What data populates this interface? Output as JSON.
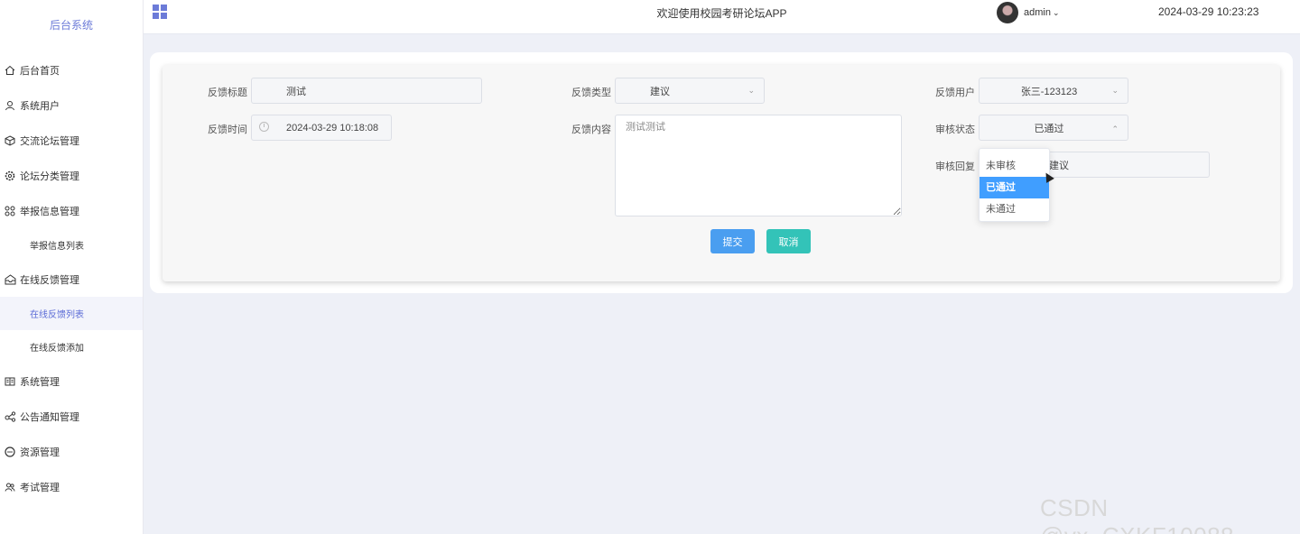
{
  "sidebar": {
    "brand": "后台系统",
    "items": [
      {
        "label": "后台首页",
        "icon": "home-icon"
      },
      {
        "label": "系统用户",
        "icon": "user-icon"
      },
      {
        "label": "交流论坛管理",
        "icon": "cube-icon"
      },
      {
        "label": "论坛分类管理",
        "icon": "gear-icon"
      },
      {
        "label": "举报信息管理",
        "icon": "apps-icon"
      },
      {
        "label": "举报信息列表"
      },
      {
        "label": "在线反馈管理",
        "icon": "inbox-icon"
      },
      {
        "label": "在线反馈列表"
      },
      {
        "label": "在线反馈添加"
      },
      {
        "label": "系统管理",
        "icon": "book-icon"
      },
      {
        "label": "公告通知管理",
        "icon": "share-icon"
      },
      {
        "label": "资源管理",
        "icon": "chat-icon"
      },
      {
        "label": "考试管理",
        "icon": "people-icon"
      }
    ]
  },
  "header": {
    "title": "欢迎使用校园考研论坛APP",
    "user": "admin",
    "datetime": "2024-03-29 10:23:23"
  },
  "form": {
    "title_label": "反馈标题",
    "title_value": "测试",
    "type_label": "反馈类型",
    "type_value": "建议",
    "user_label": "反馈用户",
    "user_value": "张三-123123",
    "time_label": "反馈时间",
    "time_value": "2024-03-29 10:18:08",
    "content_label": "反馈内容",
    "content_value": "测试测试",
    "status_label": "审核状态",
    "status_value": "已通过",
    "reply_label": "审核回复",
    "reply_value": "建议",
    "submit": "提交",
    "cancel": "取消"
  },
  "status_options": [
    "未审核",
    "已通过",
    "未通过"
  ],
  "watermark": "CSDN @vx_CXKF10088",
  "colors": {
    "accent": "#6c7bd8",
    "primary": "#409eff",
    "submit": "#4a9ef0",
    "cancel": "#33c3b8"
  }
}
